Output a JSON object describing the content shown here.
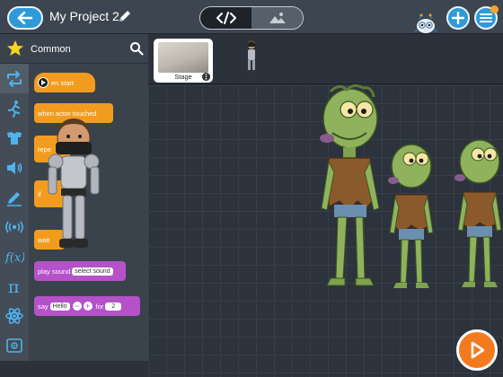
{
  "header": {
    "project_title": "My Project 2",
    "view_toggle": {
      "code_label": "</>",
      "scene_label": "scene"
    }
  },
  "palette": {
    "category_label": "Common",
    "blocks": [
      {
        "label": "en start",
        "color": "orange"
      },
      {
        "label": "when actor touched",
        "color": "orange"
      },
      {
        "label": "repe",
        "color": "orange"
      },
      {
        "label": "if",
        "color": "orange"
      },
      {
        "label": "wait",
        "color": "orange"
      },
      {
        "label": "play sound",
        "field": "select sound",
        "color": "purple"
      },
      {
        "label": "say",
        "field": "Hello",
        "for_label": "for",
        "for_value": "2",
        "color": "purple"
      }
    ],
    "rail_icons": [
      "repeat-icon",
      "motion-icon",
      "looks-icon",
      "sound-icon",
      "pen-icon",
      "broadcast-icon",
      "function-icon",
      "pi-icon",
      "atom-icon",
      "image-icon"
    ]
  },
  "sprites": {
    "stage_label": "Stage"
  },
  "colors": {
    "accent": "#2f9ad8",
    "block_orange": "#f29c1f",
    "block_purple": "#b552c9",
    "play": "#f47a20"
  }
}
